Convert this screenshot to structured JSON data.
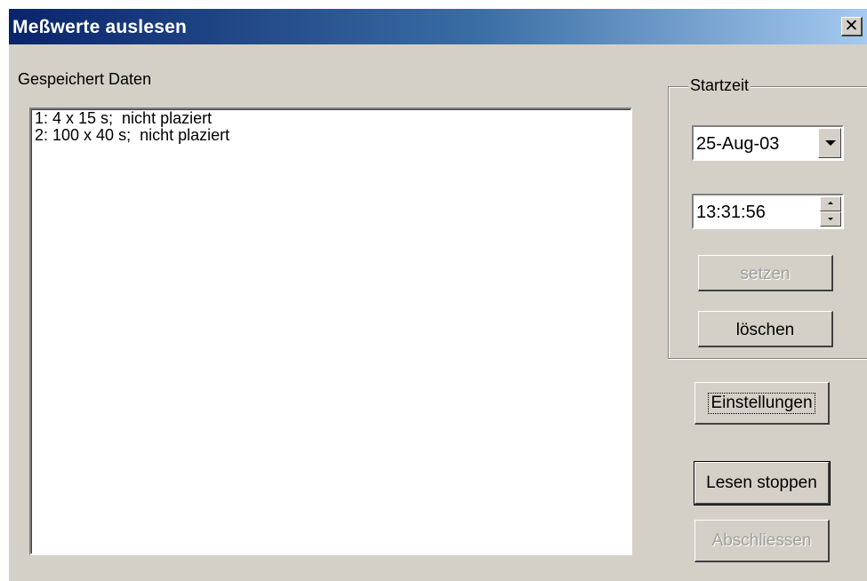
{
  "window": {
    "title": "Meßwerte auslesen",
    "close_glyph": "✕",
    "close_icon": "close-icon"
  },
  "main": {
    "list_label": "Gespeichert Daten",
    "items": [
      {
        "text": "1: 4 x 15 s;  nicht plaziert"
      },
      {
        "text": "2: 100 x 40 s;  nicht plaziert"
      }
    ]
  },
  "startzeit": {
    "group_label": "Startzeit",
    "date_value": "25-Aug-03",
    "time_value": "13:31:56",
    "set_label": "setzen",
    "delete_label": "löschen"
  },
  "actions": {
    "settings_label": "Einstellungen",
    "stop_label": "Lesen stoppen",
    "finish_label": "Abschliessen"
  },
  "colors": {
    "title_gradient_start": "#0a246a",
    "title_gradient_end": "#a6caf0",
    "dialog_face": "#d4d0c8"
  }
}
